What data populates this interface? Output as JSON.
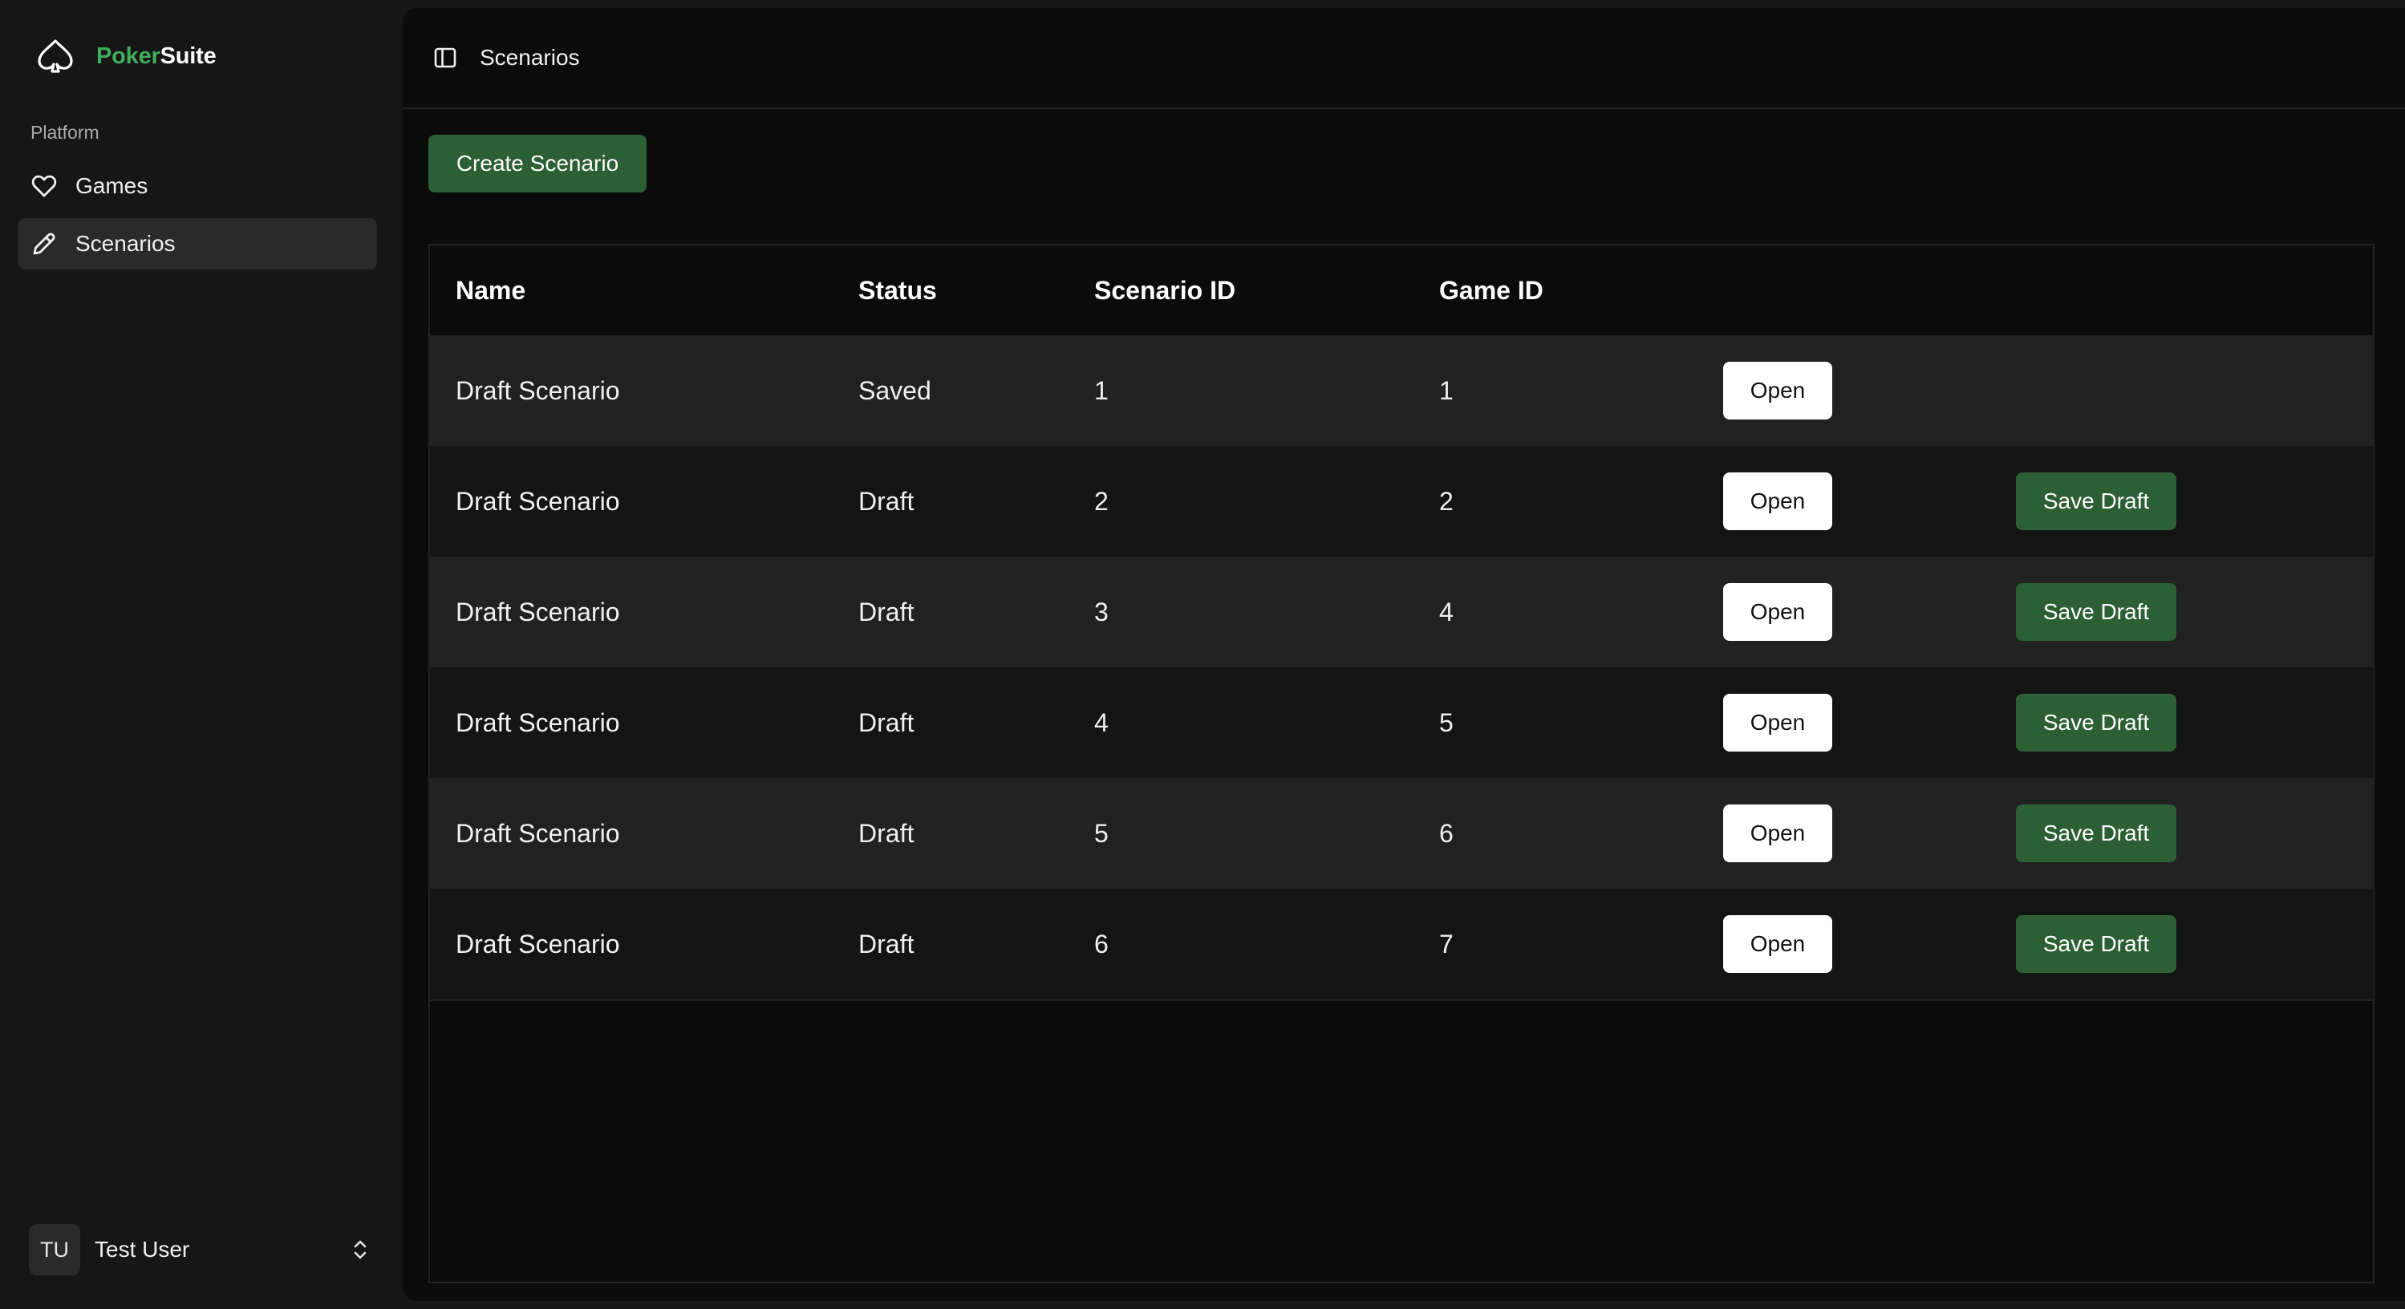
{
  "brand": {
    "name_part1": "Poker",
    "name_part2": "Suite",
    "accent_color": "#3fae5a",
    "logo_icon": "spade-outline-icon"
  },
  "sidebar": {
    "section_label": "Platform",
    "items": [
      {
        "label": "Games",
        "icon": "heart-icon",
        "active": false
      },
      {
        "label": "Scenarios",
        "icon": "pencil-icon",
        "active": true
      }
    ],
    "user": {
      "initials": "TU",
      "name": "Test User",
      "icon": "chevrons-up-down-icon"
    }
  },
  "header": {
    "title": "Scenarios",
    "toggle_icon": "sidebar-toggle-icon"
  },
  "actions": {
    "create_label": "Create Scenario",
    "button_color": "#2d5f34"
  },
  "table": {
    "columns": [
      "Name",
      "Status",
      "Scenario ID",
      "Game ID"
    ],
    "rows": [
      {
        "name": "Draft Scenario",
        "status": "Saved",
        "scenario_id": "1",
        "game_id": "1",
        "open_label": "Open",
        "save_label": ""
      },
      {
        "name": "Draft Scenario",
        "status": "Draft",
        "scenario_id": "2",
        "game_id": "2",
        "open_label": "Open",
        "save_label": "Save Draft"
      },
      {
        "name": "Draft Scenario",
        "status": "Draft",
        "scenario_id": "3",
        "game_id": "4",
        "open_label": "Open",
        "save_label": "Save Draft"
      },
      {
        "name": "Draft Scenario",
        "status": "Draft",
        "scenario_id": "4",
        "game_id": "5",
        "open_label": "Open",
        "save_label": "Save Draft"
      },
      {
        "name": "Draft Scenario",
        "status": "Draft",
        "scenario_id": "5",
        "game_id": "6",
        "open_label": "Open",
        "save_label": "Save Draft"
      },
      {
        "name": "Draft Scenario",
        "status": "Draft",
        "scenario_id": "6",
        "game_id": "7",
        "open_label": "Open",
        "save_label": "Save Draft"
      }
    ]
  }
}
